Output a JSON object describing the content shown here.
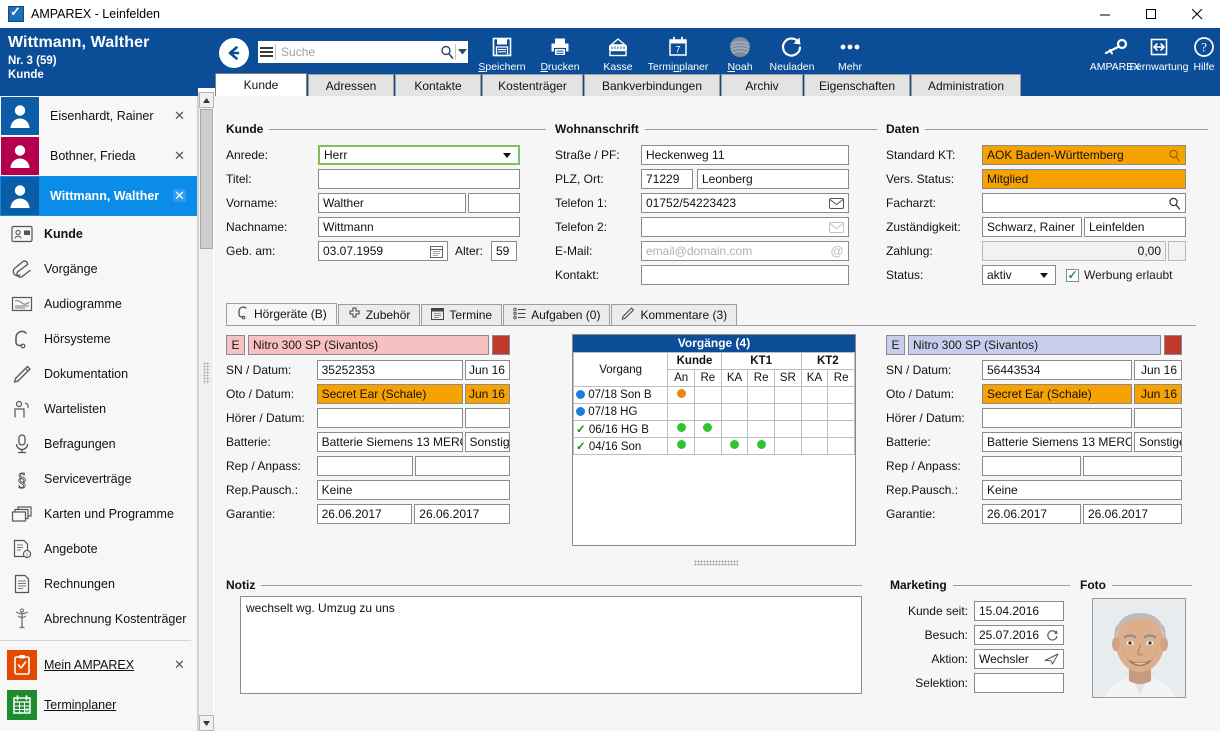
{
  "window": {
    "title": "AMPAREX - Leinfelden",
    "minimize": "—",
    "maximize": "□",
    "close": "✕"
  },
  "customer_header": {
    "name": "Wittmann, Walther",
    "number": "Nr. 3 (59)",
    "type": "Kunde"
  },
  "search": {
    "placeholder": "Suche",
    "value": ""
  },
  "toolbar": {
    "items": [
      {
        "label": "Speichern",
        "icon": "save-icon",
        "accel": "S"
      },
      {
        "label": "Drucken",
        "icon": "print-icon",
        "accel": "D"
      },
      {
        "label": "Kasse",
        "icon": "cash-register-icon",
        "accel": ""
      },
      {
        "label": "Terminplaner",
        "icon": "calendar-icon",
        "accel": "n"
      },
      {
        "label": "Noah",
        "icon": "noah-sphere-icon",
        "accel": "N"
      },
      {
        "label": "Neuladen",
        "icon": "reload-icon",
        "accel": ""
      },
      {
        "label": "Mehr",
        "icon": "more-dots-icon",
        "accel": ""
      }
    ],
    "right_items": [
      {
        "label": "AMPAREX",
        "icon": "key-icon"
      },
      {
        "label": "Fernwartung",
        "icon": "remote-support-icon"
      },
      {
        "label": "Hilfe",
        "icon": "help-icon"
      }
    ]
  },
  "tabs": {
    "active": "Kunde",
    "items": [
      "Kunde",
      "Adressen",
      "Kontakte",
      "Kostenträger",
      "Bankverbindungen",
      "Archiv",
      "Eigenschaften",
      "Administration"
    ]
  },
  "sidebar": {
    "customers": [
      {
        "label": "Eisenhardt, Rainer",
        "color": "#0b5da8",
        "selected": false,
        "close": "✕"
      },
      {
        "label": "Bothner, Frieda",
        "color": "#b4004e",
        "selected": false,
        "close": "✕"
      },
      {
        "label": "Wittmann, Walther",
        "color": "#0b5da8",
        "selected": true,
        "close": "✕"
      }
    ],
    "nav": [
      {
        "label": "Kunde",
        "icon": "contact-card-icon",
        "bold": true
      },
      {
        "label": "Vorgänge",
        "icon": "paperclip-icon",
        "bold": false
      },
      {
        "label": "Audiogramme",
        "icon": "audiogram-icon",
        "bold": false
      },
      {
        "label": "Hörsysteme",
        "icon": "hearing-aid-icon",
        "bold": false
      },
      {
        "label": "Dokumentation",
        "icon": "pencil-icon",
        "bold": false
      },
      {
        "label": "Wartelisten",
        "icon": "waiting-list-icon",
        "bold": false
      },
      {
        "label": "Befragungen",
        "icon": "microphone-icon",
        "bold": false
      },
      {
        "label": "Serviceverträge",
        "icon": "paragraph-icon",
        "bold": false
      },
      {
        "label": "Karten und Programme",
        "icon": "cards-icon",
        "bold": false
      },
      {
        "label": "Angebote",
        "icon": "offer-document-icon",
        "bold": false
      },
      {
        "label": "Rechnungen",
        "icon": "invoice-icon",
        "bold": false
      },
      {
        "label": "Abrechnung Kostenträger",
        "icon": "caduceus-icon",
        "bold": false
      }
    ],
    "apps": [
      {
        "label": "Mein AMPAREX",
        "icon": "clipboard-check-icon",
        "color": "#e24a00",
        "close": "✕"
      },
      {
        "label": "Terminplaner",
        "icon": "calendar-green-icon",
        "color": "#1e8b2e",
        "close": ""
      }
    ]
  },
  "kunde_group": {
    "title": "Kunde",
    "fields": {
      "anrede_label": "Anrede:",
      "anrede_value": "Herr",
      "titel_label": "Titel:",
      "titel_value": "",
      "vorname_label": "Vorname:",
      "vorname_value": "Walther",
      "vorname_extra": "",
      "nachname_label": "Nachname:",
      "nachname_value": "Wittmann",
      "geb_label": "Geb. am:",
      "geb_value": "03.07.1959",
      "alter_label": "Alter:",
      "alter_value": "59"
    }
  },
  "wohnanschrift_group": {
    "title": "Wohnanschrift",
    "fields": {
      "strasse_label": "Straße / PF:",
      "strasse_value": "Heckenweg 11",
      "plz_label": "PLZ, Ort:",
      "plz_value": "71229",
      "ort_value": "Leonberg",
      "tel1_label": "Telefon 1:",
      "tel1_value": "01752/54223423",
      "tel2_label": "Telefon 2:",
      "tel2_value": "",
      "email_label": "E-Mail:",
      "email_value": "",
      "email_placeholder": "email@domain.com",
      "kontakt_label": "Kontakt:",
      "kontakt_value": ""
    }
  },
  "daten_group": {
    "title": "Daten",
    "fields": {
      "kt_label": "Standard KT:",
      "kt_value": "AOK Baden-Württemberg",
      "vers_label": "Vers. Status:",
      "vers_value": "Mitglied",
      "facharzt_label": "Facharzt:",
      "facharzt_value": "",
      "zustaendig_label": "Zuständigkeit:",
      "zustaendig_value": "Schwarz, Rainer",
      "zustaendig_ort": "Leinfelden",
      "zahlung_label": "Zahlung:",
      "zahlung_value": "0,00",
      "status_label": "Status:",
      "status_value": "aktiv",
      "werbung_label": "Werbung erlaubt",
      "werbung_checked": true
    }
  },
  "inner_tabs": {
    "active": "Hörgeräte (B)",
    "items": [
      {
        "label": "Hörgeräte (B)",
        "icon": "hearing-aid-icon"
      },
      {
        "label": "Zubehör",
        "icon": "plus-icon"
      },
      {
        "label": "Termine",
        "icon": "calendar-icon"
      },
      {
        "label": "Aufgaben (0)",
        "icon": "task-list-icon"
      },
      {
        "label": "Kommentare (3)",
        "icon": "pencil-icon"
      }
    ]
  },
  "device_left": {
    "side": "E",
    "name": "Nitro 300 SP (Sivantos)",
    "swatch_color": "#c0392b",
    "rows": [
      {
        "label": "SN / Datum:",
        "value": "35252353",
        "value2": "Jun 16",
        "highlight": false
      },
      {
        "label": "Oto / Datum:",
        "value": "Secret Ear (Schale)",
        "value2": "Jun 16",
        "highlight": true
      },
      {
        "label": "Hörer / Datum:",
        "value": "",
        "value2": "",
        "highlight": false
      },
      {
        "label": "Batterie:",
        "value": "Batterie Siemens 13 MERC",
        "value2": "Sonstige",
        "highlight": false
      },
      {
        "label": "Rep / Anpass:",
        "value": "",
        "value2": "",
        "highlight": false
      },
      {
        "label": "Rep.Pausch.:",
        "value": "Keine",
        "value2": null,
        "highlight": false
      },
      {
        "label": "Garantie:",
        "value": "26.06.2017",
        "value2": "26.06.2017",
        "highlight": false
      }
    ]
  },
  "device_right": {
    "side": "E",
    "name": "Nitro 300 SP (Sivantos)",
    "swatch_color": "#c0392b",
    "rows": [
      {
        "label": "SN / Datum:",
        "value": "56443534",
        "value2": "Jun 16",
        "highlight": false
      },
      {
        "label": "Oto / Datum:",
        "value": "Secret Ear (Schale)",
        "value2": "Jun 16",
        "highlight": true
      },
      {
        "label": "Hörer / Datum:",
        "value": "",
        "value2": "",
        "highlight": false
      },
      {
        "label": "Batterie:",
        "value": "Batterie Siemens 13 MERC",
        "value2": "Sonstige",
        "highlight": false
      },
      {
        "label": "Rep / Anpass:",
        "value": "",
        "value2": "",
        "highlight": false
      },
      {
        "label": "Rep.Pausch.:",
        "value": "Keine",
        "value2": null,
        "highlight": false
      },
      {
        "label": "Garantie:",
        "value": "26.06.2017",
        "value2": "26.06.2017",
        "highlight": false
      }
    ]
  },
  "vorgaenge": {
    "title": "Vorgänge (4)",
    "col_vorgang": "Vorgang",
    "groups": [
      {
        "label": "Kunde",
        "cols": [
          "An",
          "Re"
        ]
      },
      {
        "label": "KT1",
        "cols": [
          "KA",
          "Re",
          "SR"
        ]
      },
      {
        "label": "KT2",
        "cols": [
          "KA",
          "Re"
        ]
      }
    ],
    "rows": [
      {
        "status": "open",
        "name": "07/18 Son B",
        "cells": [
          "orange",
          "",
          "",
          "",
          "",
          "",
          ""
        ]
      },
      {
        "status": "open",
        "name": "07/18 HG",
        "cells": [
          "",
          "",
          "",
          "",
          "",
          "",
          ""
        ]
      },
      {
        "status": "done",
        "name": "06/16 HG  B",
        "cells": [
          "green",
          "green",
          "",
          "",
          "",
          "",
          ""
        ]
      },
      {
        "status": "done",
        "name": "04/16 Son",
        "cells": [
          "green",
          "",
          "green",
          "green",
          "",
          "",
          ""
        ]
      }
    ]
  },
  "notiz": {
    "title": "Notiz",
    "value": "wechselt wg. Umzug zu uns"
  },
  "marketing": {
    "title": "Marketing",
    "fields": {
      "kunde_seit_label": "Kunde seit:",
      "kunde_seit_value": "15.04.2016",
      "besuch_label": "Besuch:",
      "besuch_value": "25.07.2016",
      "aktion_label": "Aktion:",
      "aktion_value": "Wechsler",
      "selektion_label": "Selektion:",
      "selektion_value": ""
    }
  },
  "foto": {
    "title": "Foto",
    "alt": "customer-photo"
  },
  "colors": {
    "brand_blue": "#0b4d96",
    "select_blue": "#0c8ce9",
    "orange_highlight": "#f6a200",
    "pink_highlight": "#f7c1c1",
    "lavender_highlight": "#c9cded",
    "green_dot": "#2fc52f",
    "orange_dot": "#e08a12"
  }
}
